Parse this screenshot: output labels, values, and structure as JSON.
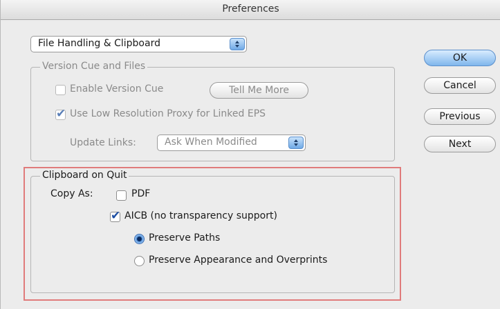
{
  "window": {
    "title": "Preferences"
  },
  "panel_selector": {
    "value": "File Handling & Clipboard"
  },
  "version_cue_group": {
    "legend": "Version Cue and Files",
    "enable_version_cue": {
      "label": "Enable Version Cue",
      "checked": false
    },
    "tell_me_more": "Tell Me More",
    "low_res_proxy": {
      "label": "Use Low Resolution Proxy for Linked EPS",
      "checked": true
    },
    "update_links_label": "Update Links:",
    "update_links_value": "Ask When Modified"
  },
  "clipboard_group": {
    "legend": "Clipboard on Quit",
    "copy_as_label": "Copy As:",
    "pdf": {
      "label": "PDF",
      "checked": false
    },
    "aicb": {
      "label": "AICB (no transparency support)",
      "checked": true
    },
    "preserve_paths": {
      "label": "Preserve Paths",
      "selected": true
    },
    "preserve_appearance": {
      "label": "Preserve Appearance and Overprints",
      "selected": false
    }
  },
  "buttons": {
    "ok": "OK",
    "cancel": "Cancel",
    "previous": "Previous",
    "next": "Next"
  },
  "colors": {
    "highlight": "#e07b7b",
    "aqua": "#6fa9e6"
  }
}
